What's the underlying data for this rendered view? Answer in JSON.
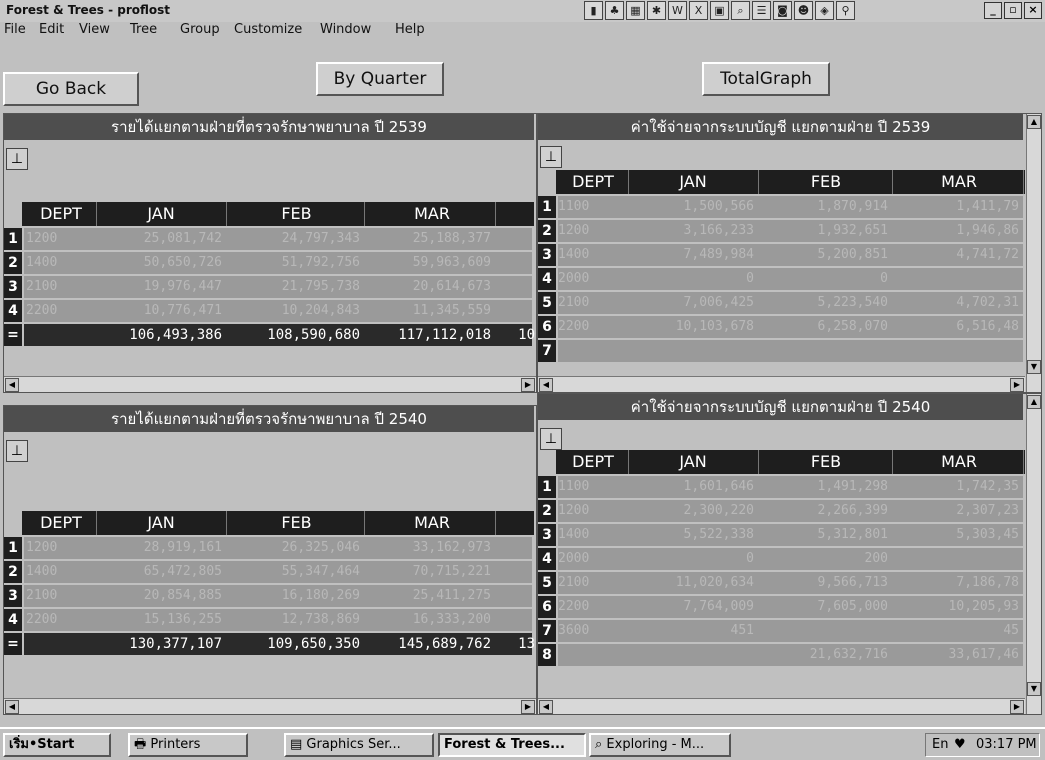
{
  "app": {
    "title": "Forest & Trees - proflost",
    "menu": [
      "File",
      "Edit",
      "View",
      "Tree",
      "Group",
      "Customize",
      "Window",
      "Help"
    ],
    "window_buttons": [
      "_",
      "▫",
      "×"
    ]
  },
  "toolbar": {
    "go_back": "Go Back",
    "by_quarter": "By Quarter",
    "total_graph": "TotalGraph"
  },
  "panels": [
    {
      "title": "รายได้แยกตามฝ่ายที่ตรวจรักษาพยาบาล ปี 2539",
      "headers": [
        "DEPT",
        "JAN",
        "FEB",
        "MAR"
      ],
      "rows": [
        {
          "num": "1",
          "cells": [
            "1200",
            "25,081,742",
            "24,797,343",
            "25,188,377"
          ]
        },
        {
          "num": "2",
          "cells": [
            "1400",
            "50,650,726",
            "51,792,756",
            "59,963,609"
          ]
        },
        {
          "num": "3",
          "cells": [
            "2100",
            "19,976,447",
            "21,795,738",
            "20,614,673"
          ]
        },
        {
          "num": "4",
          "cells": [
            "2200",
            "10,776,471",
            "10,204,843",
            "11,345,559"
          ]
        },
        {
          "num": "=",
          "cells": [
            "",
            "106,493,386",
            "108,590,680",
            "117,112,018",
            "10"
          ],
          "total": true
        }
      ]
    },
    {
      "title": "ค่าใช้จ่ายจากระบบบัญชี แยกตามฝ่าย ปี 2539",
      "headers": [
        "DEPT",
        "JAN",
        "FEB",
        "MAR"
      ],
      "rows": [
        {
          "num": "1",
          "cells": [
            "1100",
            "1,500,566",
            "1,870,914",
            "1,411,79"
          ]
        },
        {
          "num": "2",
          "cells": [
            "1200",
            "3,166,233",
            "1,932,651",
            "1,946,86"
          ]
        },
        {
          "num": "3",
          "cells": [
            "1400",
            "7,489,984",
            "5,200,851",
            "4,741,72"
          ]
        },
        {
          "num": "4",
          "cells": [
            "2000",
            "0",
            "0",
            ""
          ]
        },
        {
          "num": "5",
          "cells": [
            "2100",
            "7,006,425",
            "5,223,540",
            "4,702,31"
          ]
        },
        {
          "num": "6",
          "cells": [
            "2200",
            "10,103,678",
            "6,258,070",
            "6,516,48"
          ]
        },
        {
          "num": "7",
          "cells": [
            "",
            "",
            "",
            ""
          ]
        }
      ]
    },
    {
      "title": "รายได้แยกตามฝ่ายที่ตรวจรักษาพยาบาล ปี 2540",
      "headers": [
        "DEPT",
        "JAN",
        "FEB",
        "MAR"
      ],
      "rows": [
        {
          "num": "1",
          "cells": [
            "1200",
            "28,919,161",
            "26,325,046",
            "33,162,973"
          ]
        },
        {
          "num": "2",
          "cells": [
            "1400",
            "65,472,805",
            "55,347,464",
            "70,715,221"
          ]
        },
        {
          "num": "3",
          "cells": [
            "2100",
            "20,854,885",
            "16,180,269",
            "25,411,275"
          ]
        },
        {
          "num": "4",
          "cells": [
            "2200",
            "15,136,255",
            "12,738,869",
            "16,333,200"
          ]
        },
        {
          "num": "=",
          "cells": [
            "",
            "130,377,107",
            "109,650,350",
            "145,689,762",
            "13"
          ],
          "total": true
        }
      ]
    },
    {
      "title": "ค่าใช้จ่ายจากระบบบัญชี แยกตามฝ่าย ปี 2540",
      "headers": [
        "DEPT",
        "JAN",
        "FEB",
        "MAR"
      ],
      "rows": [
        {
          "num": "1",
          "cells": [
            "1100",
            "1,601,646",
            "1,491,298",
            "1,742,35"
          ]
        },
        {
          "num": "2",
          "cells": [
            "1200",
            "2,300,220",
            "2,266,399",
            "2,307,23"
          ]
        },
        {
          "num": "3",
          "cells": [
            "1400",
            "5,522,338",
            "5,312,801",
            "5,303,45"
          ]
        },
        {
          "num": "4",
          "cells": [
            "2000",
            "0",
            "200",
            ""
          ]
        },
        {
          "num": "5",
          "cells": [
            "2100",
            "11,020,634",
            "9,566,713",
            "7,186,78"
          ]
        },
        {
          "num": "6",
          "cells": [
            "2200",
            "7,764,009",
            "7,605,000",
            "10,205,93"
          ]
        },
        {
          "num": "7",
          "cells": [
            "3600",
            "451",
            "",
            "45"
          ]
        },
        {
          "num": "8",
          "cells": [
            "",
            "",
            "21,632,716",
            "33,617,46"
          ]
        }
      ]
    }
  ],
  "taskbar": {
    "start": "เริ่ม•Start",
    "tasks": [
      "Printers",
      "Graphics Ser...",
      "Forest & Trees...",
      "Exploring - M..."
    ],
    "tray_lang": "En",
    "clock": "03:17 PM"
  }
}
